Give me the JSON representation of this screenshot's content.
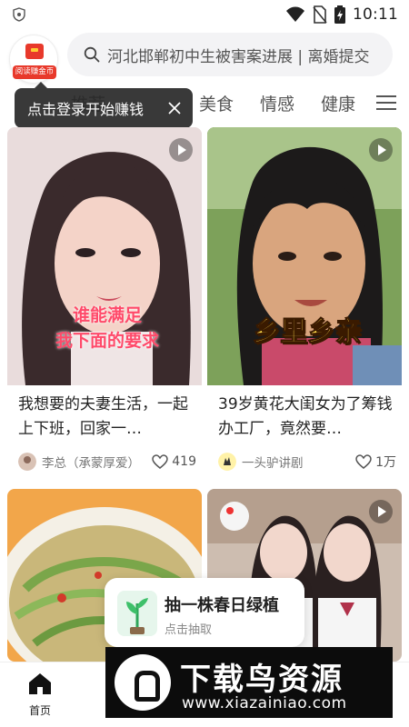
{
  "status_bar": {
    "time": "10:11"
  },
  "coin_badge": {
    "label": "阅读赚金币"
  },
  "search": {
    "hint": "河北邯郸初中生被害案进展 | 离婚提交"
  },
  "tabs": [
    {
      "label": "推荐"
    },
    {
      "label": "美食"
    },
    {
      "label": "情感"
    },
    {
      "label": "健康"
    }
  ],
  "tooltip": {
    "text": "点击登录开始赚钱"
  },
  "cards": [
    {
      "overlay_line1": "谁能满足",
      "overlay_line2": "我下面的要求",
      "title": "我想要的夫妻生活，一起上下班，回家一…",
      "author": "李总（承蒙厚爱）",
      "likes": "419"
    },
    {
      "overlay": "乡里乡亲",
      "title": "39岁黄花大闺女为了筹钱办工厂，竟然要…",
      "author": "一头驴讲剧",
      "likes": "1万"
    }
  ],
  "promo": {
    "title": "抽一株春日绿植",
    "subtitle": "点击抽取"
  },
  "bottom_nav": {
    "home_label": "首页"
  },
  "watermark": {
    "title": "下载鸟资源",
    "url": "www.xiazainiao.com"
  }
}
